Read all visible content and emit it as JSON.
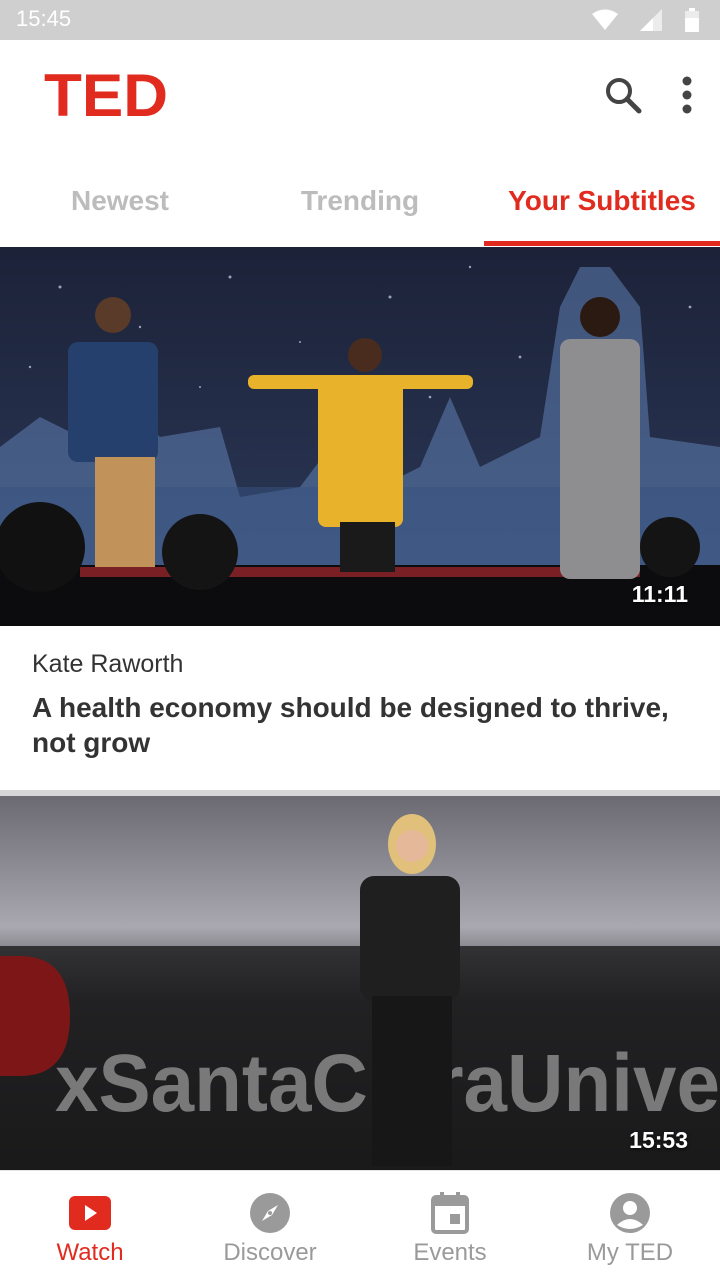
{
  "status_bar": {
    "time": "15:45"
  },
  "app": {
    "logo_text": "TED",
    "brand_color": "#e12b1f"
  },
  "header": {
    "icons": [
      "search-icon",
      "more-vert-icon"
    ]
  },
  "tabs": [
    {
      "label": "Newest",
      "active": false
    },
    {
      "label": "Trending",
      "active": false
    },
    {
      "label": "Your Subtitles",
      "active": true
    }
  ],
  "talks": [
    {
      "duration": "11:11",
      "speaker": "Kate Raworth",
      "title": "A health economy should be designed to thrive, not grow"
    },
    {
      "duration": "15:53",
      "stage_text": "xSantaClaraUnive"
    }
  ],
  "bottom_nav": [
    {
      "label": "Watch",
      "icon": "play-icon",
      "active": true
    },
    {
      "label": "Discover",
      "icon": "compass-icon",
      "active": false
    },
    {
      "label": "Events",
      "icon": "calendar-icon",
      "active": false
    },
    {
      "label": "My TED",
      "icon": "account-icon",
      "active": false
    }
  ]
}
